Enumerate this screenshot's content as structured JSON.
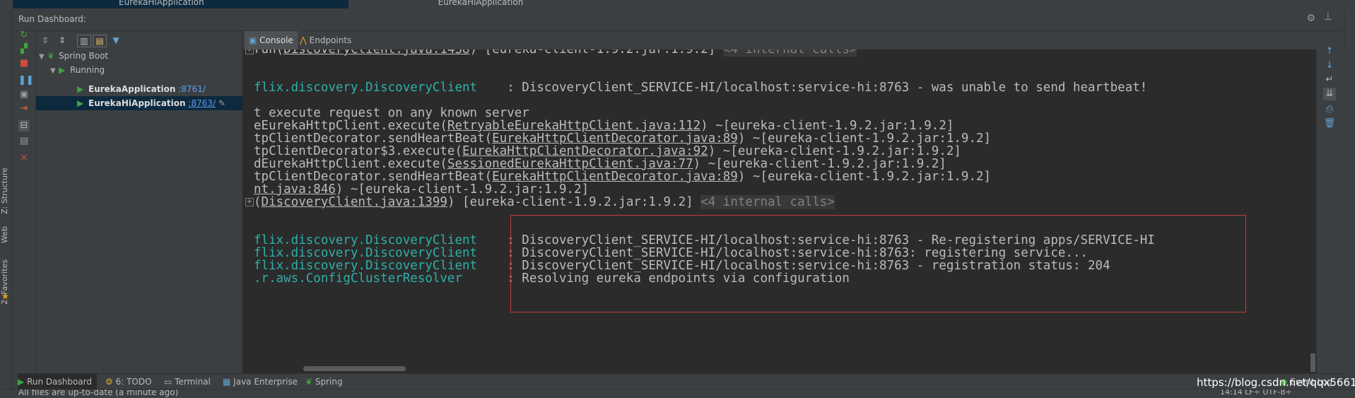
{
  "window": {
    "tab_active": "EurekaHiApplication",
    "tab_inactive": "EurekaHiApplication"
  },
  "header": {
    "title": "Run Dashboard:"
  },
  "side": {
    "structure": "Z: Structure",
    "web": "Web",
    "favorites": "2: Favorites"
  },
  "tree": {
    "root": "Spring Boot",
    "group": "Running",
    "apps": [
      {
        "name": "EurekaApplication",
        "port": ":8761/"
      },
      {
        "name": "EurekaHiApplication",
        "port": ":8763/"
      }
    ]
  },
  "console_tabs": {
    "console": "Console",
    "endpoints": "Endpoints"
  },
  "console": {
    "l1": {
      "pre": "run(",
      "link": "DiscoveryClient.java:1438",
      "post": ") [eureka-client-1.9.2.jar:1.9.2] ",
      "internal": "<4 internal calls>"
    },
    "l2": {
      "cls": "flix.discovery.DiscoveryClient",
      "msg": "    : DiscoveryClient_SERVICE-HI/localhost:service-hi:8763 - was unable to send heartbeat!"
    },
    "l3": {
      "text": "t execute request on any known server"
    },
    "l4": {
      "pre": "eEurekaHttpClient.execute(",
      "link": "RetryableEurekaHttpClient.java:112",
      "post": ") ~[eureka-client-1.9.2.jar:1.9.2]"
    },
    "l5": {
      "pre": "tpClientDecorator.sendHeartBeat(",
      "link": "EurekaHttpClientDecorator.java:89",
      "post": ") ~[eureka-client-1.9.2.jar:1.9.2]"
    },
    "l6": {
      "pre": "tpClientDecorator$3.execute(",
      "link": "EurekaHttpClientDecorator.java:92",
      "post": ") ~[eureka-client-1.9.2.jar:1.9.2]"
    },
    "l7": {
      "pre": "dEurekaHttpClient.execute(",
      "link": "SessionedEurekaHttpClient.java:77",
      "post": ") ~[eureka-client-1.9.2.jar:1.9.2]"
    },
    "l8": {
      "pre": "tpClientDecorator.sendHeartBeat(",
      "link": "EurekaHttpClientDecorator.java:89",
      "post": ") ~[eureka-client-1.9.2.jar:1.9.2]"
    },
    "l9": {
      "link": "nt.java:846",
      "post": ") ~[eureka-client-1.9.2.jar:1.9.2]"
    },
    "l10": {
      "pre": "(",
      "link": "DiscoveryClient.java:1399",
      "post": ") [eureka-client-1.9.2.jar:1.9.2] ",
      "internal": "<4 internal calls>"
    },
    "l11": {
      "cls": "flix.discovery.DiscoveryClient",
      "msg": "    : DiscoveryClient_SERVICE-HI/localhost:service-hi:8763 - Re-registering apps/SERVICE-HI"
    },
    "l12": {
      "cls": "flix.discovery.DiscoveryClient",
      "msg": "    : DiscoveryClient_SERVICE-HI/localhost:service-hi:8763: registering service..."
    },
    "l13": {
      "cls": "flix.discovery.DiscoveryClient",
      "msg": "    : DiscoveryClient_SERVICE-HI/localhost:service-hi:8763 - registration status: 204"
    },
    "l14": {
      "cls": ".r.aws.ConfigClusterResolver",
      "msg": "      : Resolving eureka endpoints via configuration"
    }
  },
  "bottom_tabs": {
    "run": "Run Dashboard",
    "todo": "6: TODO",
    "terminal": "Terminal",
    "java": "Java Enterprise",
    "spring": "Spring",
    "event": "Event Log"
  },
  "status": {
    "text": "All files are up-to-date (a minute ago)",
    "right": "14:14   LF÷   UTF-8÷"
  },
  "watermark": "https://blog.csdn.net/qqx5661",
  "colors": {
    "accent": "#589df6",
    "selection": "#0d293e",
    "highlight_box": "#c43b3b",
    "class_name": "#2eafa8"
  }
}
